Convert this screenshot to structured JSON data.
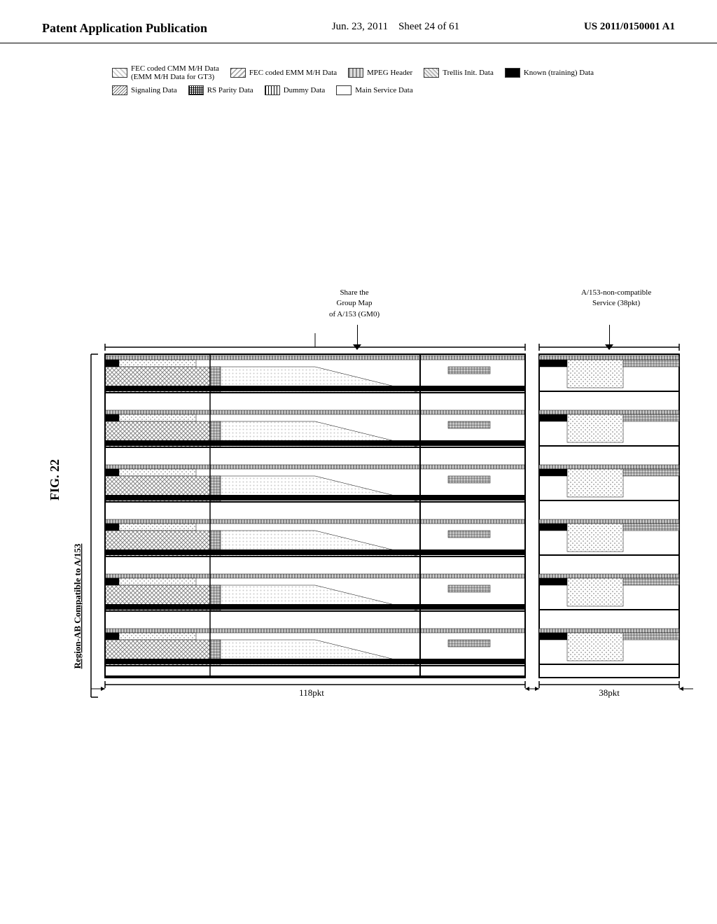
{
  "header": {
    "title": "Patent Application Publication",
    "date": "Jun. 23, 2011",
    "sheet": "Sheet 24 of 61",
    "patent_number": "US 2011/0150001 A1"
  },
  "figure": {
    "label": "FIG. 22"
  },
  "legend": {
    "items": [
      {
        "id": "fec-cmm",
        "label": "FEC coded CMM M/H Data\n(EMM M/H Data for GT3)",
        "pattern": "pattern-fec-cmm"
      },
      {
        "id": "fec-emm",
        "label": "FEC coded EMM M/H Data",
        "pattern": "pattern-fec-emm"
      },
      {
        "id": "mpeg",
        "label": "MPEG Header",
        "pattern": "pattern-mpeg"
      },
      {
        "id": "trellis",
        "label": "Trellis Init. Data",
        "pattern": "pattern-trellis"
      },
      {
        "id": "known",
        "label": "Known (training) Data",
        "pattern": "pattern-known"
      },
      {
        "id": "signaling",
        "label": "Signaling Data",
        "pattern": "pattern-signaling"
      },
      {
        "id": "rs-parity",
        "label": "RS Parity Data",
        "pattern": "pattern-rs-parity"
      },
      {
        "id": "dummy",
        "label": "Dummy Data",
        "pattern": "pattern-dummy"
      },
      {
        "id": "main-service",
        "label": "Main Service Data",
        "pattern": "pattern-main-service"
      }
    ]
  },
  "annotations": {
    "share_group_map": "Share the\nGroup Map\nof A/153 (GM0)",
    "non_compatible": "A/153-non-compatible\nService (38pkt)",
    "region_label": "Region-AB Compatible to A/153",
    "pkt_118": "118pkt",
    "pkt_38": "38pkt"
  },
  "colors": {
    "background": "#ffffff",
    "border": "#000000",
    "text": "#000000"
  }
}
